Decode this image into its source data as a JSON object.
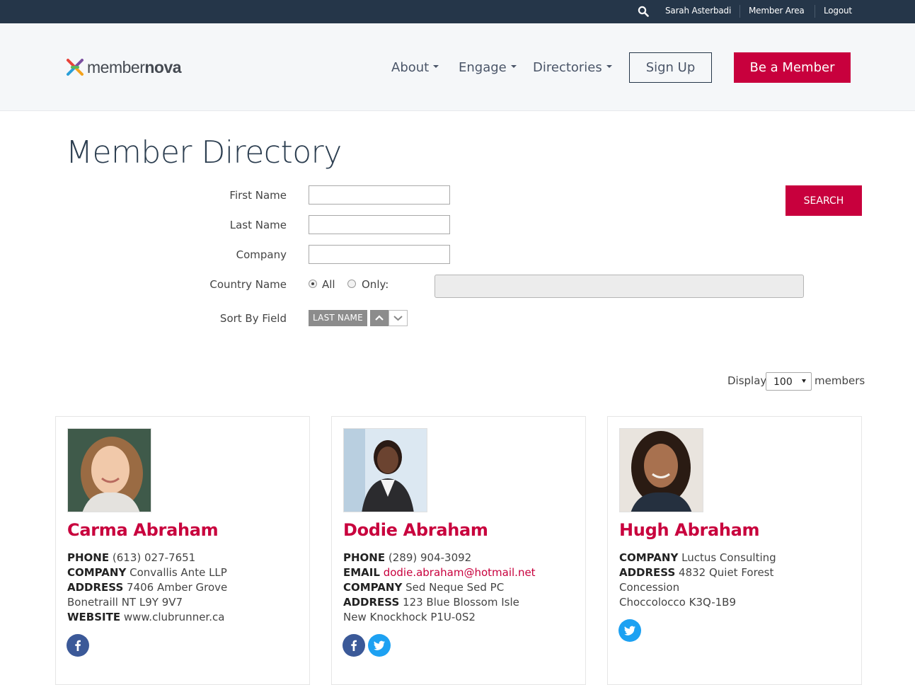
{
  "topbar": {
    "user_name": "Sarah Asterbadi",
    "member_area": "Member Area",
    "logout": "Logout"
  },
  "header": {
    "logo_word_a": "member",
    "logo_word_b": "nova",
    "nav": [
      "About",
      "Engage",
      "Directories"
    ],
    "signup": "Sign Up",
    "be_member": "Be a Member"
  },
  "page": {
    "title": "Member Directory"
  },
  "form": {
    "first_name_label": "First Name",
    "first_name_value": "",
    "last_name_label": "Last Name",
    "last_name_value": "",
    "company_label": "Company",
    "company_value": "",
    "country_label": "Country Name",
    "country_all": "All",
    "country_only": "Only:",
    "country_selected": "All",
    "sort_label": "Sort By Field",
    "sort_value": "LAST NAME",
    "search_button": "SEARCH",
    "display_label": "Display",
    "display_value": "100",
    "members_label": "members"
  },
  "members": [
    {
      "name": "Carma Abraham",
      "lines": [
        {
          "label": "PHONE",
          "value": "(613) 027-7651"
        },
        {
          "label": "COMPANY",
          "value": "Convallis Ante LLP"
        },
        {
          "label": "ADDRESS",
          "value": "7406 Amber Grove"
        },
        {
          "label": "",
          "value": "Bonetraill NT L9Y 9V7"
        },
        {
          "label": "WEBSITE",
          "value": "www.clubrunner.ca"
        }
      ],
      "social": [
        "facebook-icon"
      ]
    },
    {
      "name": "Dodie Abraham",
      "lines": [
        {
          "label": "PHONE",
          "value": "(289) 904-3092"
        },
        {
          "label": "EMAIL",
          "value": "dodie.abraham@hotmail.net"
        },
        {
          "label": "COMPANY",
          "value": "Sed Neque Sed PC"
        },
        {
          "label": "ADDRESS",
          "value": "123 Blue Blossom Isle"
        },
        {
          "label": "",
          "value": "New Knockhock P1U-0S2"
        }
      ],
      "social": [
        "facebook-icon",
        "twitter-icon"
      ]
    },
    {
      "name": "Hugh Abraham",
      "lines": [
        {
          "label": "COMPANY",
          "value": "Luctus Consulting"
        },
        {
          "label": "ADDRESS",
          "value": "4832 Quiet Forest"
        },
        {
          "label": "",
          "value": "Concession"
        },
        {
          "label": "",
          "value": "Choccolocco K3Q-1B9"
        }
      ],
      "social": [
        "twitter-icon"
      ]
    }
  ],
  "colors": {
    "topbar": "#253649",
    "accent": "#c8003d",
    "facebook": "#3b5998",
    "twitter": "#1da1f2"
  }
}
